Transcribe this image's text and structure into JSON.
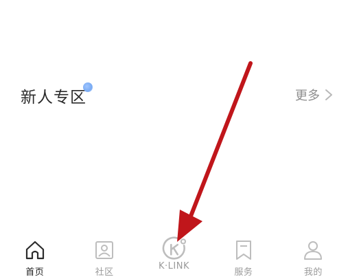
{
  "section": {
    "title": "新人专区",
    "more_label": "更多"
  },
  "tabbar": {
    "tabs": [
      {
        "label": "首页",
        "icon": "home-icon",
        "active": true
      },
      {
        "label": "社区",
        "icon": "community-icon",
        "active": false
      },
      {
        "label": "K·LINK",
        "icon": "klink-icon",
        "active": false
      },
      {
        "label": "服务",
        "icon": "service-icon",
        "active": false
      },
      {
        "label": "我的",
        "icon": "profile-icon",
        "active": false
      }
    ]
  },
  "colors": {
    "text_primary": "#2b2b2b",
    "text_secondary": "#9a9a9a",
    "icon_inactive": "#bdbdbd",
    "annotation_arrow": "#c0161b",
    "blue_dot": "#4d8fef"
  }
}
